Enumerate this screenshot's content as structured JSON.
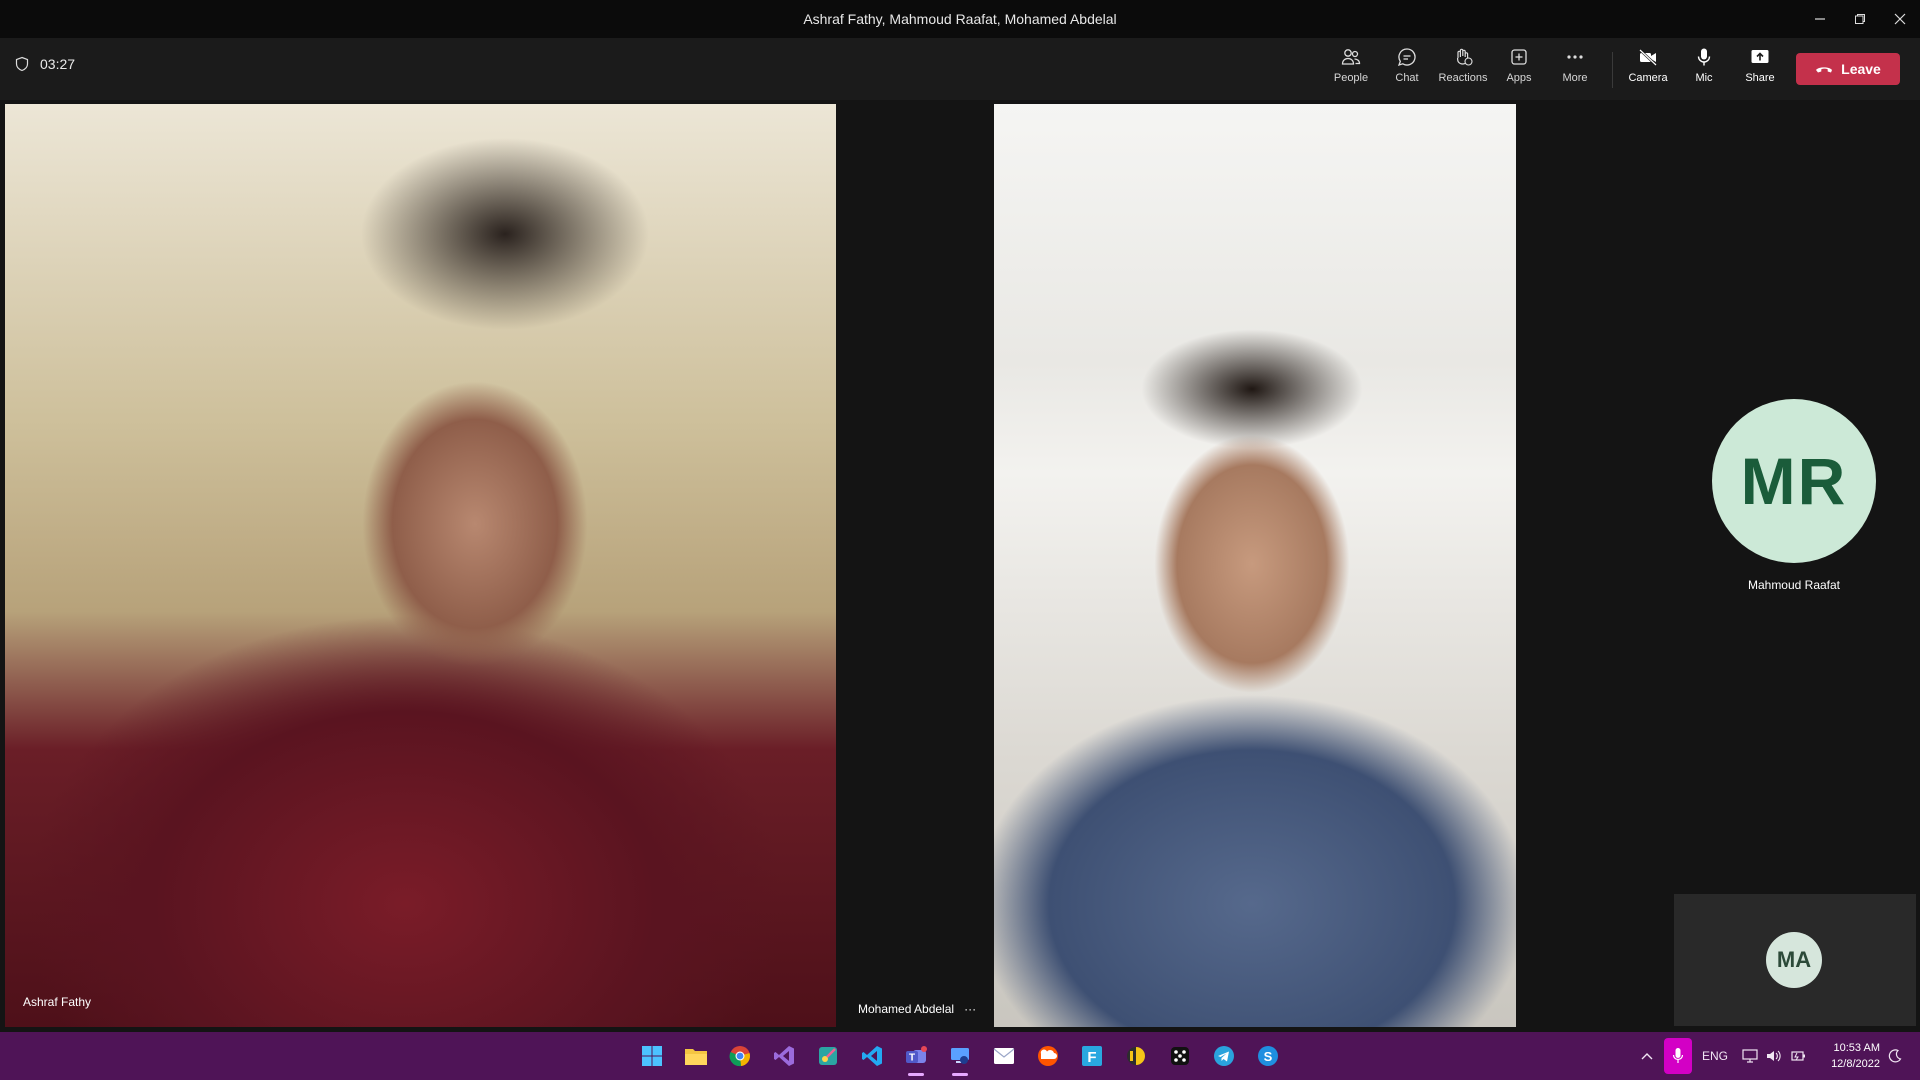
{
  "window": {
    "title": "Ashraf Fathy, Mahmoud Raafat, Mohamed Abdelal",
    "controls": [
      "minimize",
      "restore",
      "close"
    ]
  },
  "toolbar": {
    "timer": "03:27",
    "buttons": [
      {
        "label": "People",
        "icon": "people-icon"
      },
      {
        "label": "Chat",
        "icon": "chat-icon"
      },
      {
        "label": "Reactions",
        "icon": "reactions-icon"
      },
      {
        "label": "Apps",
        "icon": "apps-icon"
      },
      {
        "label": "More",
        "icon": "more-icon"
      },
      {
        "label": "Camera",
        "icon": "camera-off-icon"
      },
      {
        "label": "Mic",
        "icon": "mic-icon"
      },
      {
        "label": "Share",
        "icon": "share-icon"
      }
    ],
    "leave_label": "Leave",
    "leave_color": "#c4314b"
  },
  "participants": [
    {
      "name": "Ashraf Fathy",
      "video": true
    },
    {
      "name": "Mohamed Abdelal",
      "video": true,
      "more": "···"
    },
    {
      "name": "Mahmoud Raafat",
      "initials": "MR",
      "video": false
    },
    {
      "initials": "MA",
      "self_view": true
    }
  ],
  "taskbar": {
    "accent": "#4f1457",
    "apps": [
      "windows-start-icon",
      "file-explorer-icon",
      "chrome-icon",
      "visual-studio-icon",
      "snipping-tool-icon",
      "vscode-icon",
      "teams-icon",
      "remote-desktop-icon",
      "mail-icon",
      "soundcloud-icon",
      "app-f-icon",
      "ilspy-icon",
      "dice-app-icon",
      "telegram-icon",
      "skype-icon"
    ],
    "language": "ENG",
    "time": "10:53 AM",
    "date": "12/8/2022"
  }
}
